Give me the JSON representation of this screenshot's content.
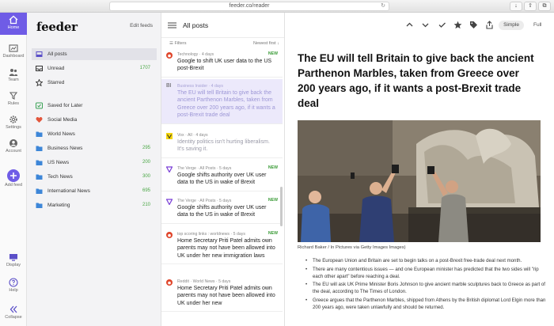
{
  "browser": {
    "url": "feeder.co/reader"
  },
  "rail": {
    "items": [
      {
        "label": "Home",
        "icon": "home-icon"
      },
      {
        "label": "Dashboard",
        "icon": "dashboard-icon"
      },
      {
        "label": "Team",
        "icon": "team-icon"
      },
      {
        "label": "Rules",
        "icon": "rules-icon"
      },
      {
        "label": "Settings",
        "icon": "gear-icon"
      },
      {
        "label": "Account",
        "icon": "account-icon"
      },
      {
        "label": "Add feed",
        "icon": "plus-icon"
      },
      {
        "label": "Display",
        "icon": "display-icon"
      },
      {
        "label": "Help",
        "icon": "help-icon"
      },
      {
        "label": "Collapse",
        "icon": "collapse-icon"
      }
    ],
    "accent": "#6f5ce6"
  },
  "sidebar": {
    "logo": "feeder",
    "edit_feeds": "Edit feeds",
    "items": [
      {
        "label": "All posts",
        "count": ""
      },
      {
        "label": "Unread",
        "count": "1707"
      },
      {
        "label": "Starred",
        "count": ""
      },
      {
        "label": "Saved for Later",
        "count": ""
      },
      {
        "label": "Social Media",
        "count": ""
      },
      {
        "label": "World News",
        "count": ""
      },
      {
        "label": "Business News",
        "count": "295"
      },
      {
        "label": "US News",
        "count": "200"
      },
      {
        "label": "Tech News",
        "count": "300"
      },
      {
        "label": "International News",
        "count": "695"
      },
      {
        "label": "Marketing",
        "count": "210"
      }
    ]
  },
  "list": {
    "title": "All posts",
    "filters": "Filters",
    "sort": "Newest first ↓",
    "articles": [
      {
        "source": "Technology · 4 days",
        "title": "Google to shift UK user data to the US post-Brexit",
        "new": "NEW"
      },
      {
        "source": "Business Insider · 4 days",
        "title": "The EU will tell Britain to give back the ancient Parthenon Marbles, taken from Greece over 200 years ago, if it wants a post-Brexit trade deal",
        "new": "",
        "icon_text": "BI"
      },
      {
        "source": "Vox · All · 4 days",
        "title": "Identity politics isn't hurting liberalism. It's saving it.",
        "new": ""
      },
      {
        "source": "The Verge · All Posts · 5 days",
        "title": "Google shifts authority over UK user data to the US in wake of Brexit",
        "new": "NEW"
      },
      {
        "source": "The Verge · All Posts · 5 days",
        "title": "Google shifts authority over UK user data to the US in wake of Brexit",
        "new": "NEW"
      },
      {
        "source": "top scoring links : worldnews · 5 days",
        "title": "Home Secretary Priti Patel admits own parents may not have been allowed into UK under her new immigration laws",
        "new": "NEW"
      },
      {
        "source": "Reddit · World News · 5 days",
        "title": "Home Secretary Priti Patel admits own parents may not have been allowed into UK under her new",
        "new": ""
      }
    ]
  },
  "reader": {
    "simple": "Simple",
    "full": "Full",
    "headline": "The EU will tell Britain to give back the ancient Parthenon Marbles, taken from Greece over 200 years ago, if it wants a post-Brexit trade deal",
    "caption": "Richard Baker  /  In Pictures via Getty Images Images)",
    "bullets": [
      "The European Union and Britain are set to begin talks on a post-Brexit free-trade deal next month.",
      "There are many contentious issues — and one European minister has predicted that the two sides will \"rip each other apart\" before reaching a deal.",
      "The EU will ask UK Prime Minister Boris Johnson to give ancient marble sculptures back to Greece as part of the deal, according to The Times of London.",
      "Greece argues that the Parthenon Marbles, shipped from Athens by the British diplomat Lord Elgin more than 200 years ago, were taken unlawfully and should be returned."
    ]
  }
}
